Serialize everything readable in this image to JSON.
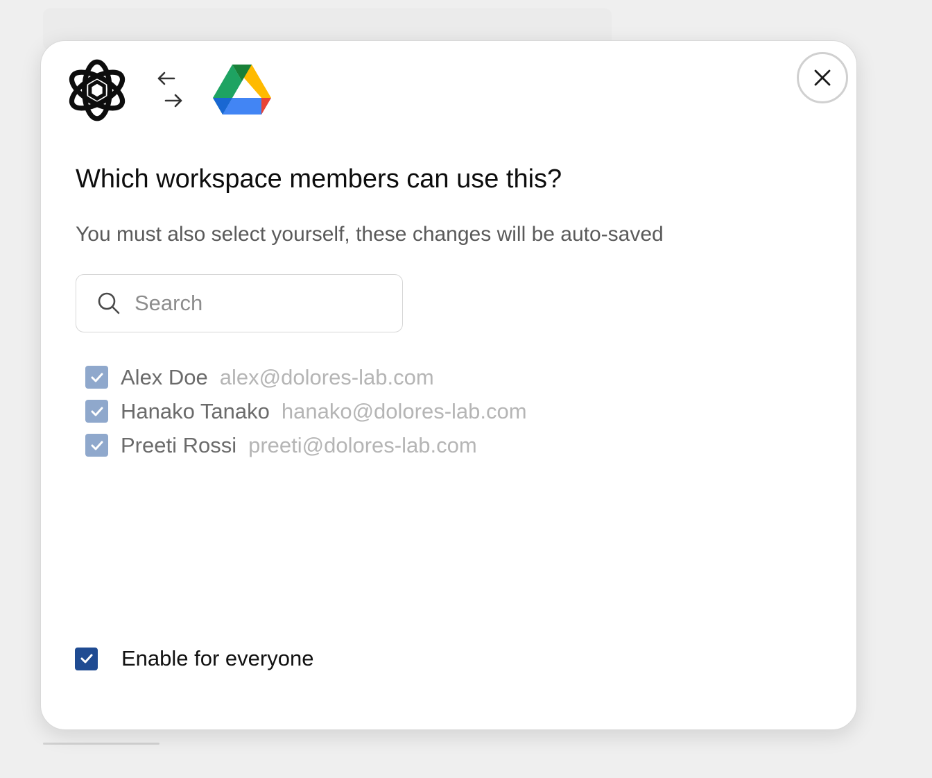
{
  "dialog": {
    "title": "Which workspace members can use this?",
    "subtitle": "You must also select yourself, these changes will be auto-saved",
    "logos": {
      "left": "openai-logo",
      "connector": "swap-arrows-icon",
      "right": "google-drive-logo"
    },
    "close_icon": "close-icon"
  },
  "search": {
    "placeholder": "Search",
    "value": ""
  },
  "members": [
    {
      "name": "Alex Doe",
      "email": "alex@dolores-lab.com",
      "checked": true
    },
    {
      "name": "Hanako Tanako",
      "email": "hanako@dolores-lab.com",
      "checked": true
    },
    {
      "name": "Preeti Rossi",
      "email": "preeti@dolores-lab.com",
      "checked": true
    }
  ],
  "enable_everyone": {
    "label": "Enable for everyone",
    "checked": true
  },
  "colors": {
    "primary_checkbox": "#1f4b92",
    "muted_checkbox": "#8fa8cc",
    "drive_green": "#1ea362",
    "drive_yellow": "#ffba00",
    "drive_blue": "#4285f4",
    "drive_red": "#ea4335"
  }
}
